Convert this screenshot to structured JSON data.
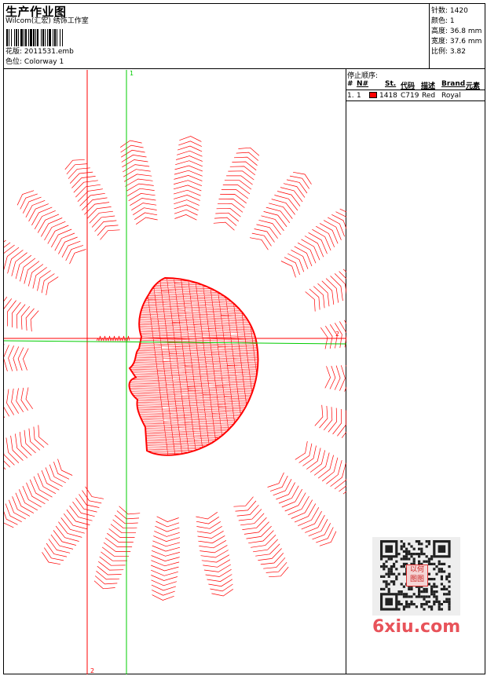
{
  "header": {
    "title": "生产作业图",
    "software": "Wilcom(汇宏) 绣饰工作室",
    "design_label": "花版:",
    "design_name": "2011531.emb",
    "color_label": "色位:",
    "colorway": "Colorway 1"
  },
  "specs": [
    {
      "label": "针数:",
      "value": "1420"
    },
    {
      "label": "颜色:",
      "value": "1"
    },
    {
      "label": "高度:",
      "value": "36.8 mm"
    },
    {
      "label": "宽度:",
      "value": "37.6 mm"
    },
    {
      "label": "比例:",
      "value": "3.82"
    }
  ],
  "sequence": {
    "title": "停止顺序:",
    "columns": [
      "#",
      "N#",
      "St.",
      "代码",
      "描述",
      "Brand",
      "元素"
    ],
    "rows": [
      {
        "num": "1.",
        "needle": "1",
        "color": "#ff0000",
        "stitches": "1418",
        "code": "C719",
        "desc": "Red",
        "brand": "Royal",
        "element": ""
      }
    ]
  },
  "design": {
    "thread_color": "#ff0000",
    "guide_color": "#00cc00",
    "guide_labels": {
      "green_top": "1",
      "red_right": "2",
      "red_bottom": "2"
    }
  },
  "watermark": {
    "qr_badge": "以何图图",
    "site": "6xiu.com"
  }
}
